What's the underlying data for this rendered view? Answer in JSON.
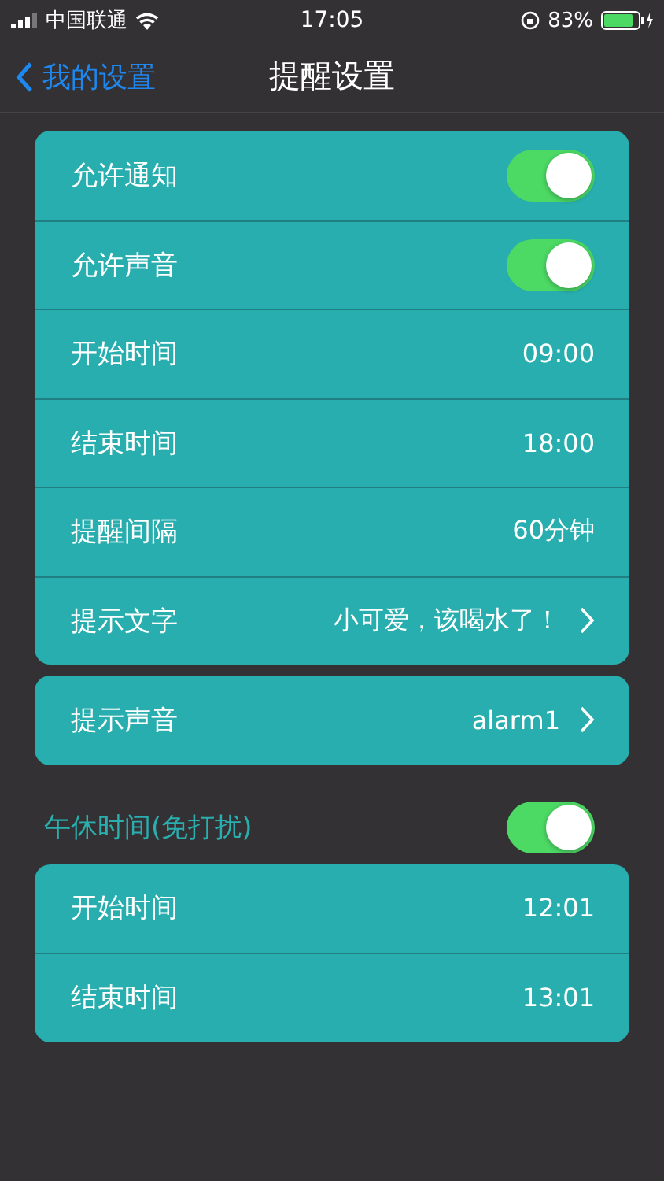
{
  "status_bar": {
    "carrier": "中国联通",
    "time": "17:05",
    "battery_percent": "83%"
  },
  "nav": {
    "back": "我的设置",
    "title": "提醒设置"
  },
  "groups": [
    {
      "rows": [
        {
          "kind": "toggle",
          "label": "允许通知",
          "on": true
        },
        {
          "kind": "toggle",
          "label": "允许声音",
          "on": true
        },
        {
          "kind": "value",
          "label": "开始时间",
          "value": "09:00"
        },
        {
          "kind": "value",
          "label": "结束时间",
          "value": "18:00"
        },
        {
          "kind": "value",
          "label": "提醒间隔",
          "value": "60分钟"
        },
        {
          "kind": "link",
          "label": "提示文字",
          "value": "小可爱，该喝水了！"
        }
      ]
    },
    {
      "rows": [
        {
          "kind": "link",
          "label": "提示声音",
          "value": "alarm1"
        }
      ]
    }
  ],
  "nap": {
    "label": "午休时间(免打扰)",
    "on": true,
    "rows": [
      {
        "kind": "value",
        "label": "开始时间",
        "value": "12:01"
      },
      {
        "kind": "value",
        "label": "结束时间",
        "value": "13:01"
      }
    ]
  }
}
